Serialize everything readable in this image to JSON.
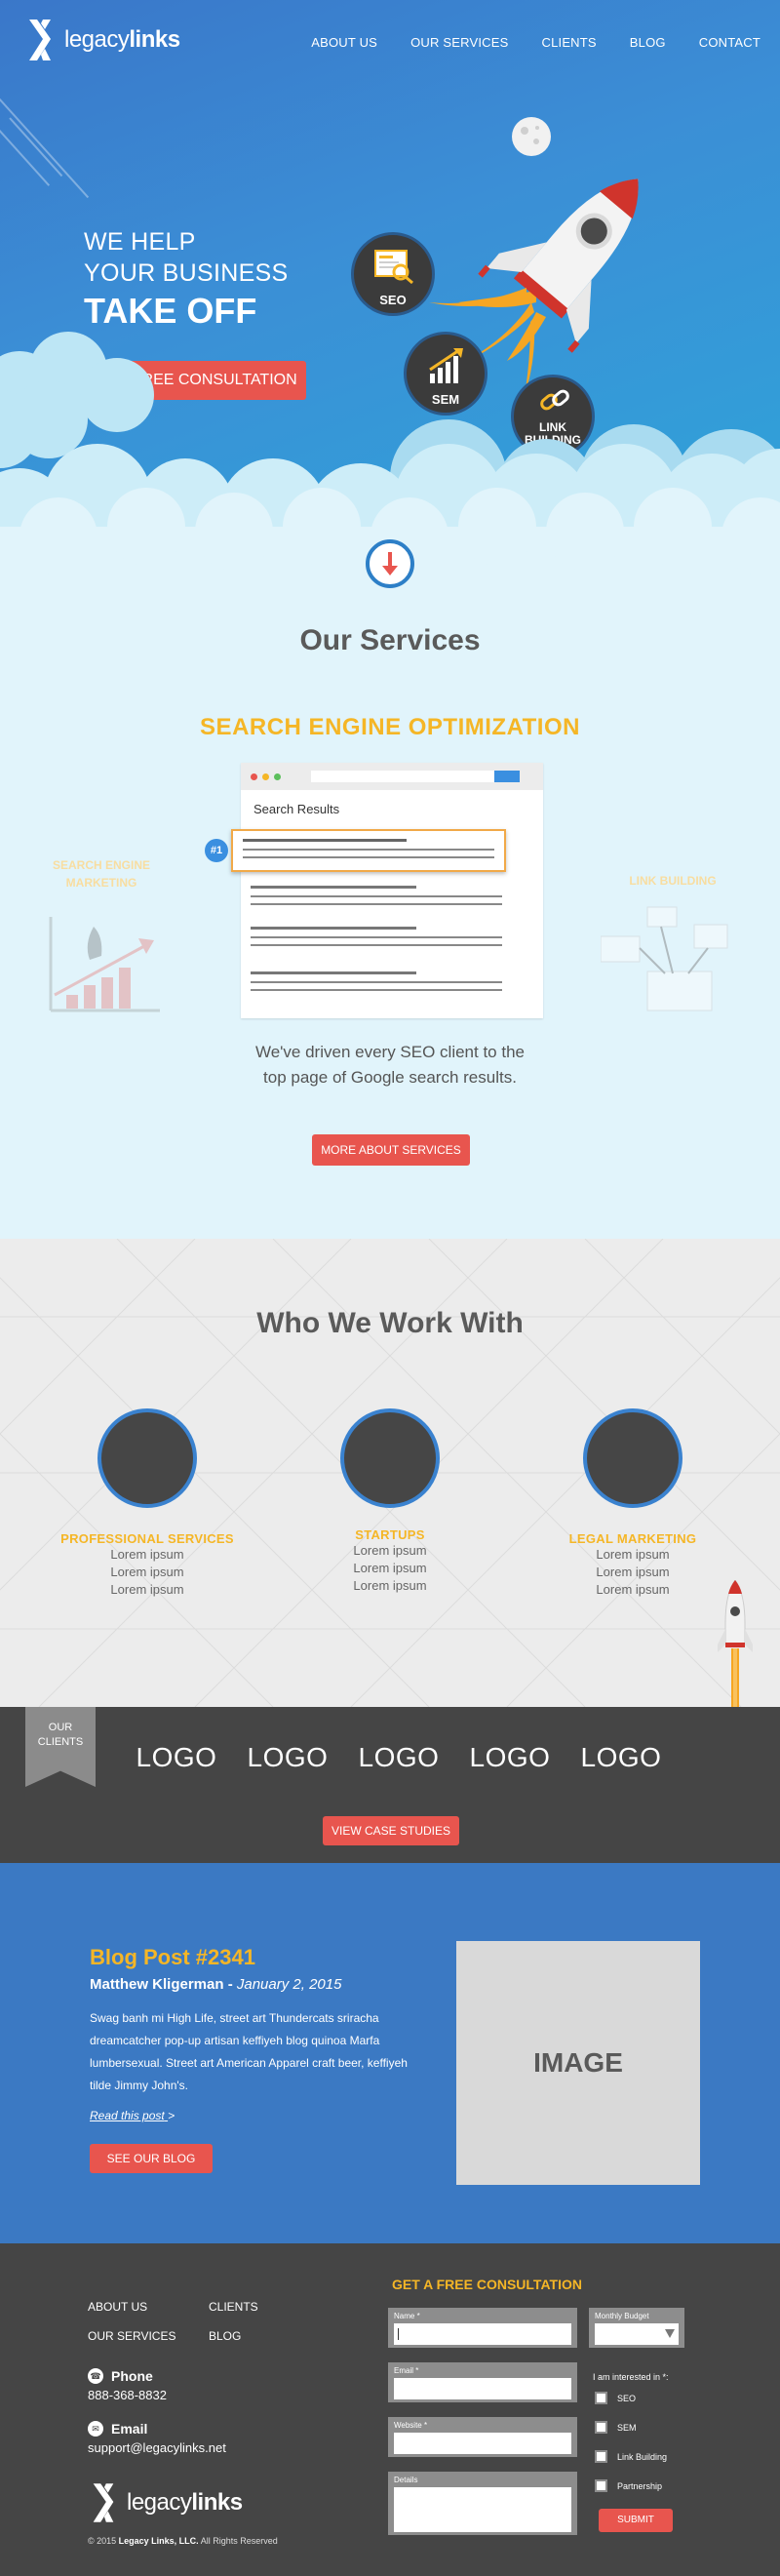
{
  "nav": {
    "brand_light": "legacy",
    "brand_bold": "links",
    "links": [
      "ABOUT US",
      "OUR SERVICES",
      "CLIENTS",
      "BLOG",
      "CONTACT"
    ]
  },
  "hero": {
    "line1": "WE HELP",
    "line2": "YOUR BUSINESS",
    "line3": "TAKE OFF",
    "cta": "GET A FREE CONSULTATION",
    "badges": {
      "seo": "SEO",
      "sem": "SEM",
      "link1": "LINK",
      "link2": "BUILDING"
    }
  },
  "services": {
    "title": "Our Services",
    "featured": "SEARCH ENGINE OPTIMIZATION",
    "left_label_1": "SEARCH ENGINE",
    "left_label_2": "MARKETING",
    "right_label": "LINK BUILDING",
    "browser_heading": "Search Results",
    "rank": "#1",
    "description_1": "We've driven every SEO client to the",
    "description_2": "top page of Google search results.",
    "cta": "MORE ABOUT SERVICES"
  },
  "who": {
    "title": "Who We Work With",
    "columns": [
      {
        "category": "PROFESSIONAL SERVICES",
        "items": [
          "Lorem ipsum",
          "Lorem ipsum",
          "Lorem ipsum"
        ]
      },
      {
        "category": "STARTUPS",
        "items": [
          "Lorem ipsum",
          "Lorem ipsum",
          "Lorem ipsum"
        ]
      },
      {
        "category": "LEGAL MARKETING",
        "items": [
          "Lorem ipsum",
          "Lorem ipsum",
          "Lorem ipsum"
        ]
      }
    ]
  },
  "clients": {
    "ribbon_1": "OUR",
    "ribbon_2": "CLIENTS",
    "logos": [
      "LOGO",
      "LOGO",
      "LOGO",
      "LOGO",
      "LOGO"
    ],
    "cta": "VIEW CASE STUDIES"
  },
  "blog": {
    "title": "Blog Post #2341",
    "author": "Matthew Kligerman",
    "separator": " - ",
    "date": "January 2, 2015",
    "body": "Swag banh mi High Life, street art Thundercats sriracha dreamcatcher pop-up artisan keffiyeh blog quinoa Marfa lumbersexual. Street art American Apparel craft beer, keffiyeh tilde Jimmy John's.",
    "read_more": "Read this post",
    "read_more_arrow": ">",
    "cta": "SEE OUR BLOG",
    "image_label": "IMAGE"
  },
  "footer": {
    "links": [
      "ABOUT US",
      "CLIENTS",
      "OUR SERVICES",
      "BLOG"
    ],
    "phone_label": "Phone",
    "phone": "888-368-8832",
    "email_label": "Email",
    "email": "support@legacylinks.net",
    "copyright_prefix": "© 2015 ",
    "copyright_company": "Legacy Links, LLC.",
    "copyright_suffix": " All Rights Reserved",
    "form": {
      "title": "GET A FREE CONSULTATION",
      "name_label": "Name *",
      "email_label": "Email *",
      "website_label": "Website *",
      "details_label": "Details",
      "budget_label": "Monthly Budget",
      "interest_label": "I am interested in *:",
      "options": [
        "SEO",
        "SEM",
        "Link Building",
        "Partnership"
      ],
      "submit": "SUBMIT"
    }
  },
  "colors": {
    "accent_red": "#e8554e",
    "accent_yellow": "#f5b626",
    "hero_blue": "#3a8fd6",
    "blog_blue": "#3b79c3",
    "dark_gray": "#454545"
  },
  "icons": [
    "logo-mark-icon",
    "moon-icon",
    "rocket-icon",
    "seo-search-icon",
    "sem-chart-icon",
    "chain-link-icon",
    "down-arrow-icon",
    "small-rocket-icon",
    "phone-icon",
    "email-icon"
  ]
}
